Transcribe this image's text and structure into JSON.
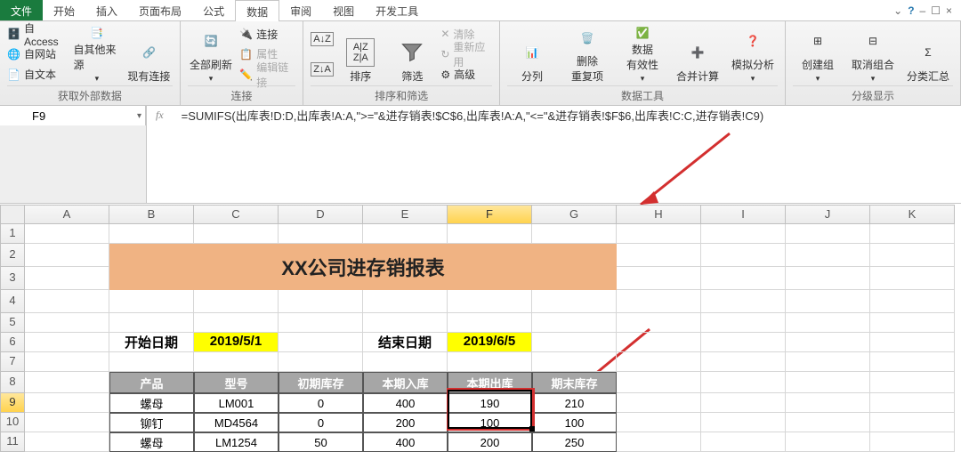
{
  "tabs": {
    "file": "文件",
    "items": [
      "开始",
      "插入",
      "页面布局",
      "公式",
      "数据",
      "审阅",
      "视图",
      "开发工具"
    ],
    "active_index": 4
  },
  "titlebar": {
    "help": "?",
    "min": "–",
    "restore": "☐",
    "close": "×",
    "caret": "⌄"
  },
  "ribbon": {
    "group_ext": {
      "access": "自 Access",
      "web": "自网站",
      "text": "自文本",
      "other": "自其他来源",
      "existing": "现有连接",
      "label": "获取外部数据"
    },
    "group_conn": {
      "refresh": "全部刷新",
      "conn": "连接",
      "prop": "属性",
      "editlink": "编辑链接",
      "label": "连接"
    },
    "group_sort": {
      "sort": "排序",
      "filter": "筛选",
      "clear": "清除",
      "reapply": "重新应用",
      "adv": "高级",
      "label": "排序和筛选"
    },
    "group_tools": {
      "split": "分列",
      "dedup": "删除\n重复项",
      "valid": "数据\n有效性",
      "consol": "合并计算",
      "whatif": "模拟分析",
      "label": "数据工具"
    },
    "group_outline": {
      "group": "创建组",
      "ungroup": "取消组合",
      "subtotal": "分类汇总",
      "label": "分级显示"
    }
  },
  "namebox": "F9",
  "formula": "=SUMIFS(出库表!D:D,出库表!A:A,\">=\"&进存销表!$C$6,出库表!A:A,\"<=\"&进存销表!$F$6,出库表!C:C,进存销表!C9)",
  "columns": [
    "A",
    "B",
    "C",
    "D",
    "E",
    "F",
    "G",
    "H",
    "I",
    "J",
    "K"
  ],
  "active_col_index": 5,
  "rows": [
    "1",
    "2",
    "3",
    "4",
    "5",
    "6",
    "7",
    "8",
    "9",
    "10",
    "11"
  ],
  "active_row_index": 8,
  "sheet": {
    "title": "XX公司进存销报表",
    "start_label": "开始日期",
    "start_date": "2019/5/1",
    "end_label": "结束日期",
    "end_date": "2019/6/5",
    "headers": [
      "产品",
      "型号",
      "初期库存",
      "本期入库",
      "本期出库",
      "期末库存"
    ],
    "data": [
      [
        "螺母",
        "LM001",
        "0",
        "400",
        "190",
        "210"
      ],
      [
        "铆钉",
        "MD4564",
        "0",
        "200",
        "100",
        "100"
      ],
      [
        "螺母",
        "LM1254",
        "50",
        "400",
        "200",
        "250"
      ]
    ]
  },
  "chart_data": {
    "type": "table",
    "title": "XX公司进存销报表",
    "columns": [
      "产品",
      "型号",
      "初期库存",
      "本期入库",
      "本期出库",
      "期末库存"
    ],
    "rows": [
      {
        "产品": "螺母",
        "型号": "LM001",
        "初期库存": 0,
        "本期入库": 400,
        "本期出库": 190,
        "期末库存": 210
      },
      {
        "产品": "铆钉",
        "型号": "MD4564",
        "初期库存": 0,
        "本期入库": 200,
        "本期出库": 100,
        "期末库存": 100
      },
      {
        "产品": "螺母",
        "型号": "LM1254",
        "初期库存": 50,
        "本期入库": 400,
        "本期出库": 200,
        "期末库存": 250
      }
    ],
    "date_range": {
      "start": "2019/5/1",
      "end": "2019/6/5"
    }
  }
}
